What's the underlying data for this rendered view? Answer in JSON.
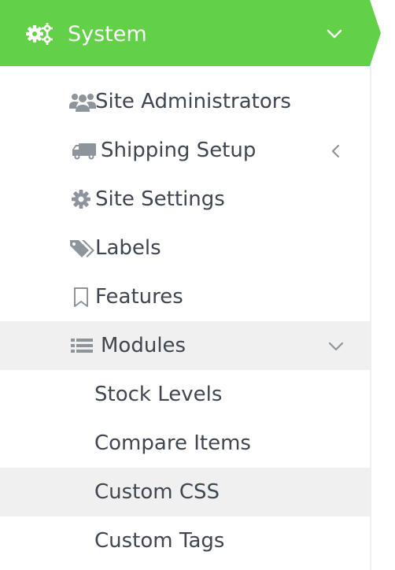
{
  "header": {
    "title": "System",
    "icon": "gears-icon",
    "chevron": "chevron-down-icon",
    "background_color": "#62d148"
  },
  "menu": {
    "items": [
      {
        "label": "Site Administrators",
        "icon": "users-icon"
      },
      {
        "label": "Shipping Setup",
        "icon": "truck-icon",
        "chevron": "chevron-left-icon"
      },
      {
        "label": "Site Settings",
        "icon": "gear-icon"
      },
      {
        "label": "Labels",
        "icon": "tags-icon"
      },
      {
        "label": "Features",
        "icon": "bookmark-icon"
      },
      {
        "label": "Modules",
        "icon": "list-icon",
        "chevron": "chevron-down-icon"
      }
    ],
    "subitems": [
      {
        "label": "Stock Levels"
      },
      {
        "label": "Compare Items"
      },
      {
        "label": "Custom CSS"
      },
      {
        "label": "Custom Tags"
      }
    ]
  },
  "colors": {
    "text": "#3f4650",
    "icon": "#8e949b",
    "active_row": "#f0f0f1"
  }
}
